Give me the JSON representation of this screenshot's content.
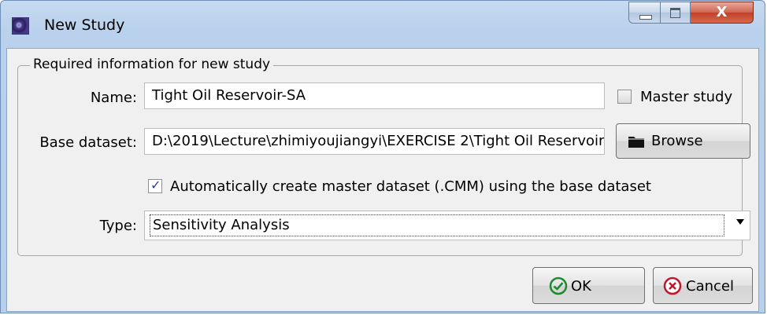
{
  "window": {
    "title": "New Study",
    "close_glyph": "X"
  },
  "group": {
    "legend": "Required information for new study"
  },
  "form": {
    "name_label": "Name:",
    "name_value": "Tight Oil Reservoir-SA",
    "master_study_label": "Master study",
    "master_study_checked": false,
    "base_dataset_label": "Base dataset:",
    "base_dataset_value": "D:\\2019\\Lecture\\zhimiyoujiangyi\\EXERCISE 2\\Tight Oil Reservoir",
    "browse_label": "Browse",
    "auto_create_label": "Automatically create master dataset (.CMM) using the base dataset",
    "auto_create_checked": true,
    "type_label": "Type:",
    "type_value": "Sensitivity Analysis"
  },
  "buttons": {
    "ok_label": "OK",
    "cancel_label": "Cancel"
  },
  "icons": {
    "app": "study-app-icon",
    "folder": "folder-icon",
    "ok": "check-circle-icon",
    "cancel": "x-circle-icon",
    "dropdown": "chevron-down-icon"
  },
  "colors": {
    "ok_green": "#1e8a2e",
    "cancel_red": "#c0182b"
  }
}
